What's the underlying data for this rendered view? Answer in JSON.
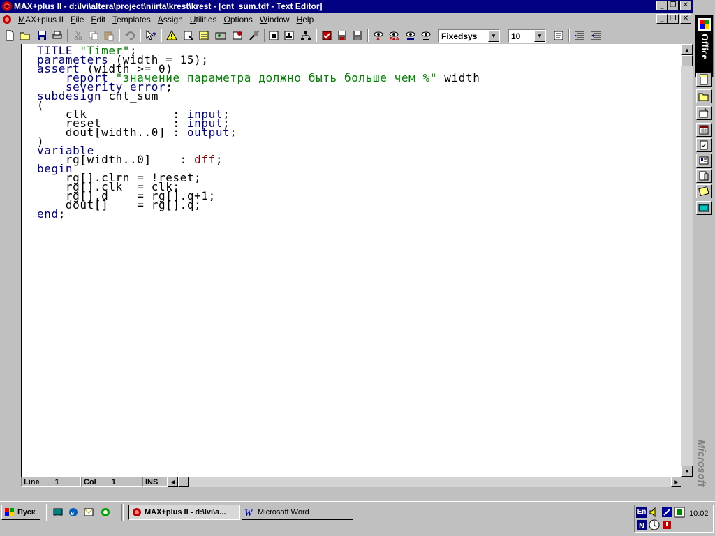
{
  "window": {
    "title": "MAX+plus II - d:\\lvi\\altera\\project\\niirta\\krest\\krest - [cnt_sum.tdf - Text Editor]",
    "minimize_glyph": "_",
    "restore_glyph": "❐",
    "close_glyph": "✕"
  },
  "menu": {
    "items": [
      {
        "label_u": "M",
        "label_rest": "AX+plus II"
      },
      {
        "label_u": "F",
        "label_rest": "ile"
      },
      {
        "label_u": "E",
        "label_rest": "dit"
      },
      {
        "label_u": "T",
        "label_rest": "emplates"
      },
      {
        "label_u": "A",
        "label_rest": "ssign"
      },
      {
        "label_u": "U",
        "label_rest": "tilities"
      },
      {
        "label_u": "O",
        "label_rest": "ptions"
      },
      {
        "label_u": "W",
        "label_rest": "indow"
      },
      {
        "label_u": "H",
        "label_rest": "elp"
      }
    ]
  },
  "toolbar": {
    "font_name": "Fixedsys",
    "font_size": "10"
  },
  "code_lines": [
    [
      [
        "kw",
        "TITLE "
      ],
      [
        "str",
        "\"Timer\""
      ],
      [
        "",
        "; "
      ]
    ],
    [
      [
        "kw",
        "parameters "
      ],
      [
        "",
        "(width = 15);"
      ]
    ],
    [
      [
        "kw",
        "assert "
      ],
      [
        "",
        "(width >= 0)"
      ]
    ],
    [
      [
        "",
        "    "
      ],
      [
        "kw",
        "report "
      ],
      [
        "str",
        "\"значение параметра должно быть больше чем %\""
      ],
      [
        "",
        " width"
      ]
    ],
    [
      [
        "",
        "    "
      ],
      [
        "kw",
        "severity error"
      ],
      [
        "",
        ";"
      ]
    ],
    [
      [
        "kw",
        "subdesign "
      ],
      [
        "",
        "cnt_sum"
      ]
    ],
    [
      [
        "",
        "("
      ]
    ],
    [
      [
        "",
        "    clk            : "
      ],
      [
        "type",
        "input"
      ],
      [
        "",
        ";"
      ]
    ],
    [
      [
        "",
        "    reset          : "
      ],
      [
        "type",
        "input"
      ],
      [
        "",
        ";"
      ]
    ],
    [
      [
        "",
        "    dout[width..0] : "
      ],
      [
        "type",
        "output"
      ],
      [
        "",
        ";"
      ]
    ],
    [
      [
        "",
        ")"
      ]
    ],
    [
      [
        "kw",
        "variable"
      ]
    ],
    [
      [
        "",
        "    rg[width..0]    : "
      ],
      [
        "dff",
        "dff"
      ],
      [
        "",
        ";"
      ]
    ],
    [
      [
        "kw",
        "begin"
      ]
    ],
    [
      [
        "",
        "    rg[].clrn = !reset;"
      ]
    ],
    [
      [
        "",
        "    rg[].clk  = clk;"
      ]
    ],
    [
      [
        "",
        "    rg[].d    = rg[].q+1;"
      ]
    ],
    [
      [
        "",
        "    dout[]    = rg[].q;"
      ]
    ],
    [
      [
        "kw",
        "end"
      ],
      [
        "",
        ";"
      ]
    ]
  ],
  "status": {
    "line_label": "Line",
    "line_value": "1",
    "col_label": "Col",
    "col_value": "1",
    "mode": "INS"
  },
  "office_bar": {
    "label": "Office",
    "brand": "Microsoft"
  },
  "taskbar": {
    "start_label": "Пуск",
    "tasks": [
      {
        "label": "MAX+plus II - d:\\lvi\\a..."
      },
      {
        "label": "Microsoft Word"
      }
    ],
    "tray_lang": "En",
    "clock": "10:02"
  }
}
